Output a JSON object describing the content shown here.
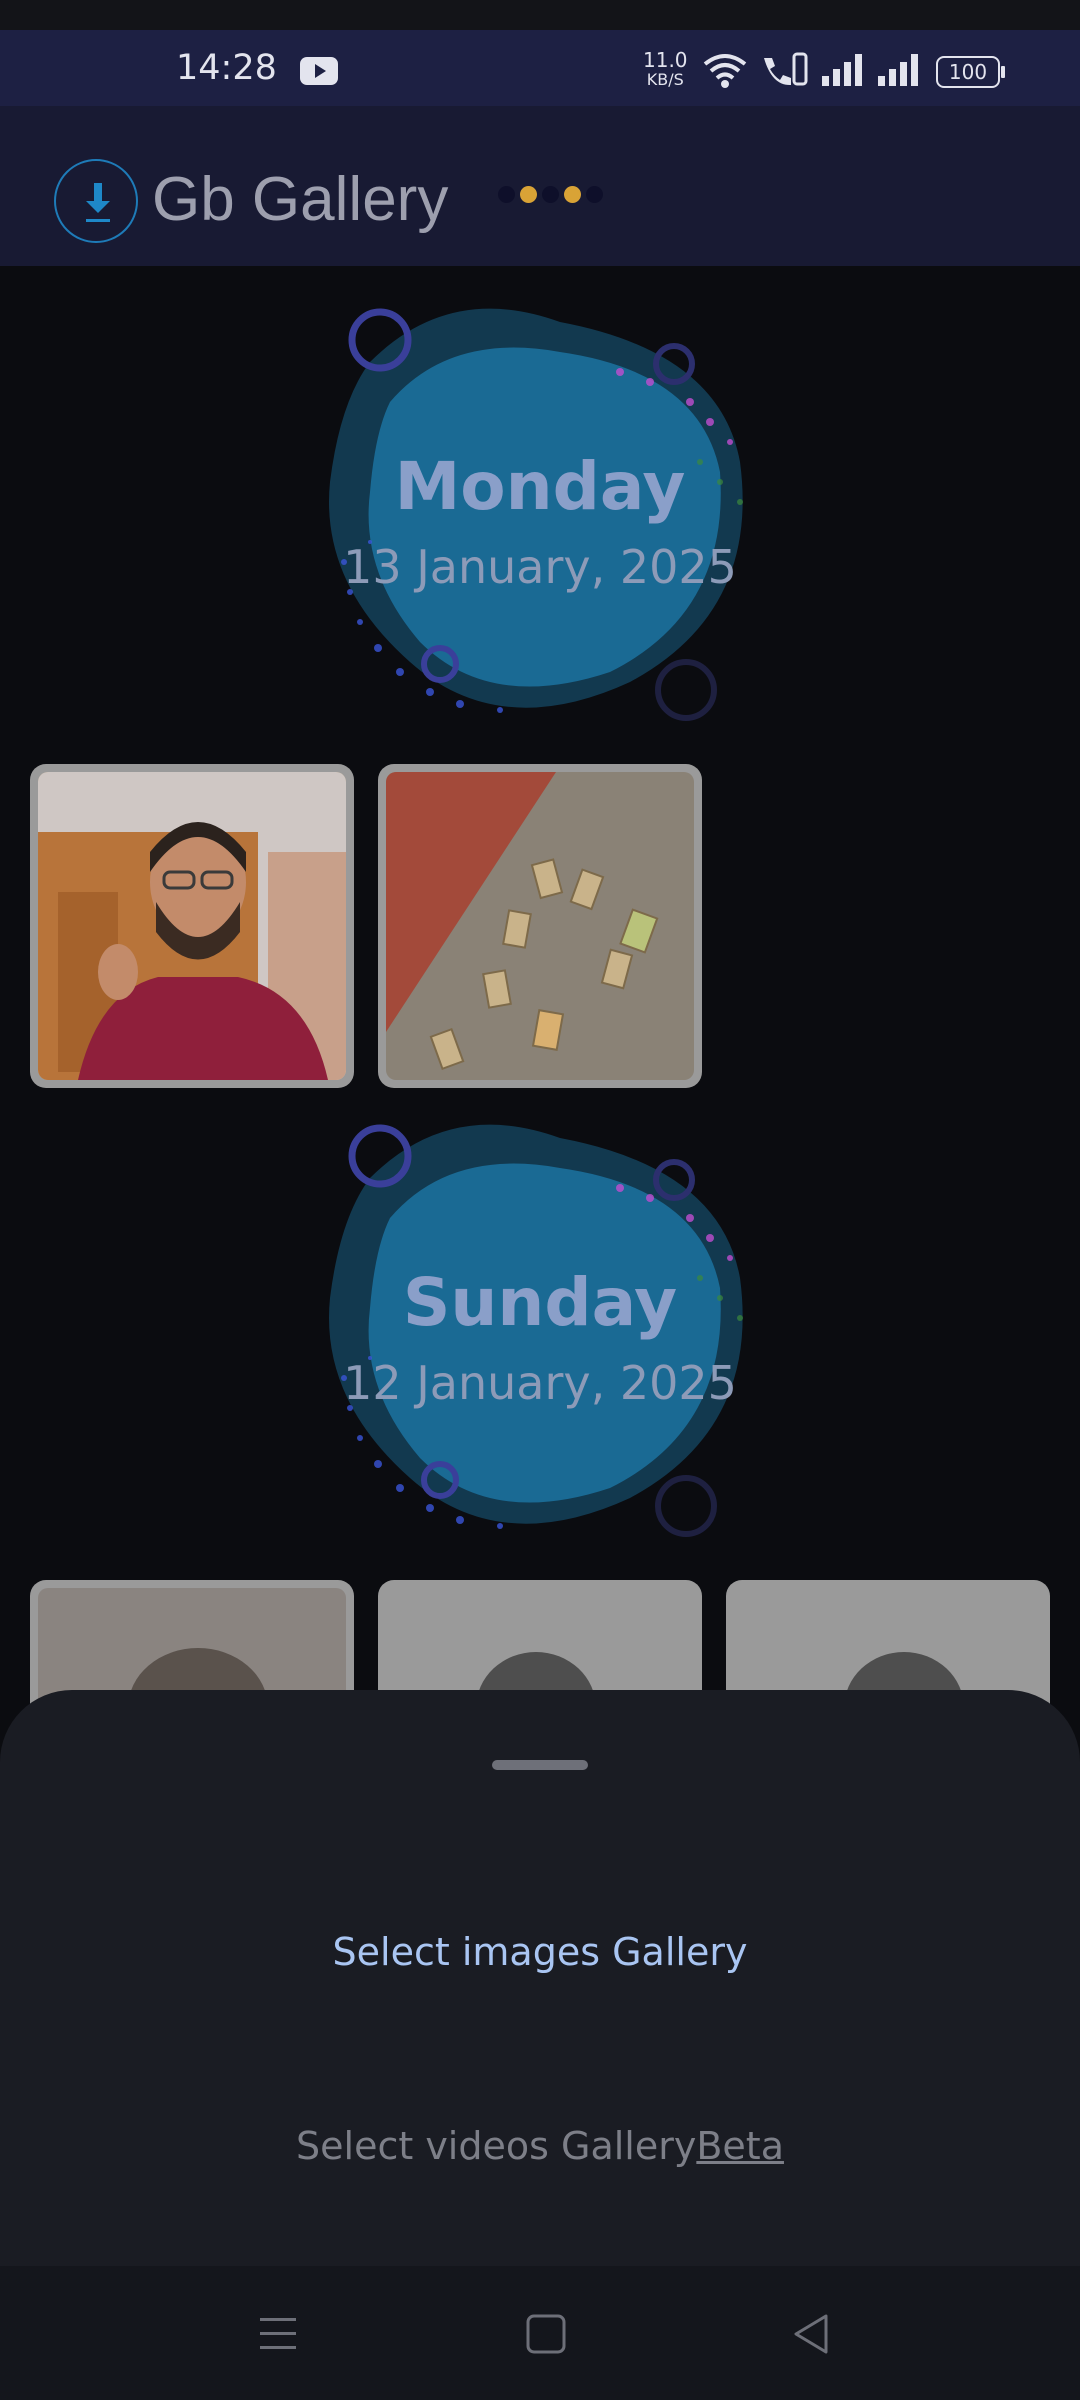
{
  "status_bar": {
    "time": "14:28",
    "net_speed_value": "11.0",
    "net_speed_unit": "KB/S",
    "battery": "100",
    "icons": [
      "youtube-icon",
      "wifi-icon",
      "call-icon",
      "signal-icon",
      "signal-icon",
      "battery-icon"
    ]
  },
  "app_bar": {
    "title": "Gb Gallery",
    "logo_icon": "download-icon",
    "dot_colors": [
      "#0e0f2a",
      "#d9a336",
      "#0e0f2a",
      "#d9a336",
      "#0e0f2a"
    ]
  },
  "sections": [
    {
      "day": "Monday",
      "date": "13 January, 2025"
    },
    {
      "day": "Sunday",
      "date": "12 January, 2025"
    }
  ],
  "sheet": {
    "option_images": "Select images Gallery",
    "option_videos": "Select videos Gallery",
    "option_videos_tag": "Beta"
  },
  "nav": {
    "icons": [
      "menu-icon",
      "home-icon",
      "back-icon"
    ]
  },
  "colors": {
    "status_bg": "#1d2043",
    "appbar_bg": "#181a33",
    "page_bg": "#0b0c10",
    "sheet_bg": "#1a1c23",
    "accent_link": "#a9c5f2",
    "blob": "#1a6a94"
  }
}
